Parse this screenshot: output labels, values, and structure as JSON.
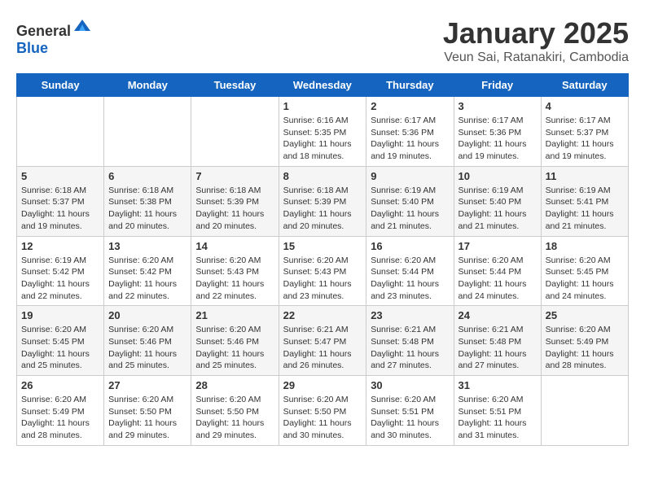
{
  "header": {
    "logo_general": "General",
    "logo_blue": "Blue",
    "title": "January 2025",
    "subtitle": "Veun Sai, Ratanakiri, Cambodia"
  },
  "weekdays": [
    "Sunday",
    "Monday",
    "Tuesday",
    "Wednesday",
    "Thursday",
    "Friday",
    "Saturday"
  ],
  "weeks": [
    [
      {
        "day": "",
        "info": ""
      },
      {
        "day": "",
        "info": ""
      },
      {
        "day": "",
        "info": ""
      },
      {
        "day": "1",
        "info": "Sunrise: 6:16 AM\nSunset: 5:35 PM\nDaylight: 11 hours and 18 minutes."
      },
      {
        "day": "2",
        "info": "Sunrise: 6:17 AM\nSunset: 5:36 PM\nDaylight: 11 hours and 19 minutes."
      },
      {
        "day": "3",
        "info": "Sunrise: 6:17 AM\nSunset: 5:36 PM\nDaylight: 11 hours and 19 minutes."
      },
      {
        "day": "4",
        "info": "Sunrise: 6:17 AM\nSunset: 5:37 PM\nDaylight: 11 hours and 19 minutes."
      }
    ],
    [
      {
        "day": "5",
        "info": "Sunrise: 6:18 AM\nSunset: 5:37 PM\nDaylight: 11 hours and 19 minutes."
      },
      {
        "day": "6",
        "info": "Sunrise: 6:18 AM\nSunset: 5:38 PM\nDaylight: 11 hours and 20 minutes."
      },
      {
        "day": "7",
        "info": "Sunrise: 6:18 AM\nSunset: 5:39 PM\nDaylight: 11 hours and 20 minutes."
      },
      {
        "day": "8",
        "info": "Sunrise: 6:18 AM\nSunset: 5:39 PM\nDaylight: 11 hours and 20 minutes."
      },
      {
        "day": "9",
        "info": "Sunrise: 6:19 AM\nSunset: 5:40 PM\nDaylight: 11 hours and 21 minutes."
      },
      {
        "day": "10",
        "info": "Sunrise: 6:19 AM\nSunset: 5:40 PM\nDaylight: 11 hours and 21 minutes."
      },
      {
        "day": "11",
        "info": "Sunrise: 6:19 AM\nSunset: 5:41 PM\nDaylight: 11 hours and 21 minutes."
      }
    ],
    [
      {
        "day": "12",
        "info": "Sunrise: 6:19 AM\nSunset: 5:42 PM\nDaylight: 11 hours and 22 minutes."
      },
      {
        "day": "13",
        "info": "Sunrise: 6:20 AM\nSunset: 5:42 PM\nDaylight: 11 hours and 22 minutes."
      },
      {
        "day": "14",
        "info": "Sunrise: 6:20 AM\nSunset: 5:43 PM\nDaylight: 11 hours and 22 minutes."
      },
      {
        "day": "15",
        "info": "Sunrise: 6:20 AM\nSunset: 5:43 PM\nDaylight: 11 hours and 23 minutes."
      },
      {
        "day": "16",
        "info": "Sunrise: 6:20 AM\nSunset: 5:44 PM\nDaylight: 11 hours and 23 minutes."
      },
      {
        "day": "17",
        "info": "Sunrise: 6:20 AM\nSunset: 5:44 PM\nDaylight: 11 hours and 24 minutes."
      },
      {
        "day": "18",
        "info": "Sunrise: 6:20 AM\nSunset: 5:45 PM\nDaylight: 11 hours and 24 minutes."
      }
    ],
    [
      {
        "day": "19",
        "info": "Sunrise: 6:20 AM\nSunset: 5:45 PM\nDaylight: 11 hours and 25 minutes."
      },
      {
        "day": "20",
        "info": "Sunrise: 6:20 AM\nSunset: 5:46 PM\nDaylight: 11 hours and 25 minutes."
      },
      {
        "day": "21",
        "info": "Sunrise: 6:20 AM\nSunset: 5:46 PM\nDaylight: 11 hours and 25 minutes."
      },
      {
        "day": "22",
        "info": "Sunrise: 6:21 AM\nSunset: 5:47 PM\nDaylight: 11 hours and 26 minutes."
      },
      {
        "day": "23",
        "info": "Sunrise: 6:21 AM\nSunset: 5:48 PM\nDaylight: 11 hours and 27 minutes."
      },
      {
        "day": "24",
        "info": "Sunrise: 6:21 AM\nSunset: 5:48 PM\nDaylight: 11 hours and 27 minutes."
      },
      {
        "day": "25",
        "info": "Sunrise: 6:20 AM\nSunset: 5:49 PM\nDaylight: 11 hours and 28 minutes."
      }
    ],
    [
      {
        "day": "26",
        "info": "Sunrise: 6:20 AM\nSunset: 5:49 PM\nDaylight: 11 hours and 28 minutes."
      },
      {
        "day": "27",
        "info": "Sunrise: 6:20 AM\nSunset: 5:50 PM\nDaylight: 11 hours and 29 minutes."
      },
      {
        "day": "28",
        "info": "Sunrise: 6:20 AM\nSunset: 5:50 PM\nDaylight: 11 hours and 29 minutes."
      },
      {
        "day": "29",
        "info": "Sunrise: 6:20 AM\nSunset: 5:50 PM\nDaylight: 11 hours and 30 minutes."
      },
      {
        "day": "30",
        "info": "Sunrise: 6:20 AM\nSunset: 5:51 PM\nDaylight: 11 hours and 30 minutes."
      },
      {
        "day": "31",
        "info": "Sunrise: 6:20 AM\nSunset: 5:51 PM\nDaylight: 11 hours and 31 minutes."
      },
      {
        "day": "",
        "info": ""
      }
    ]
  ]
}
